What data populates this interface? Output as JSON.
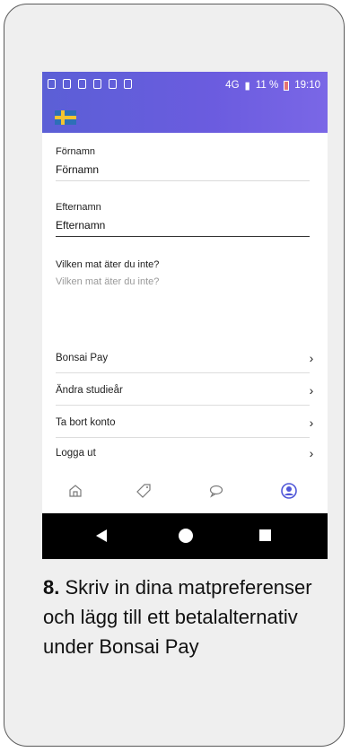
{
  "status_bar": {
    "network": "4G",
    "battery": "11 %",
    "time": "19:10"
  },
  "app_bar": {
    "flag_icon": "swedish-flag"
  },
  "form": {
    "first_name": {
      "label": "Förnamn",
      "value": "Förnamn"
    },
    "last_name": {
      "label": "Efternamn",
      "value": "Efternamn"
    },
    "food_pref": {
      "label": "Vilken mat äter du inte?",
      "placeholder": "Vilken mat äter du inte?"
    }
  },
  "menu": [
    {
      "label": "Bonsai Pay"
    },
    {
      "label": "Ändra studieår"
    },
    {
      "label": "Ta bort konto"
    },
    {
      "label": "Logga ut"
    }
  ],
  "bottom_nav": {
    "items": [
      "home-icon",
      "tag-icon",
      "chat-icon",
      "profile-icon"
    ],
    "active_color": "#4f56d8"
  },
  "caption": {
    "step": "8.",
    "text": "Skriv in dina matpreferenser och lägg till ett betalalternativ under Bonsai Pay"
  }
}
